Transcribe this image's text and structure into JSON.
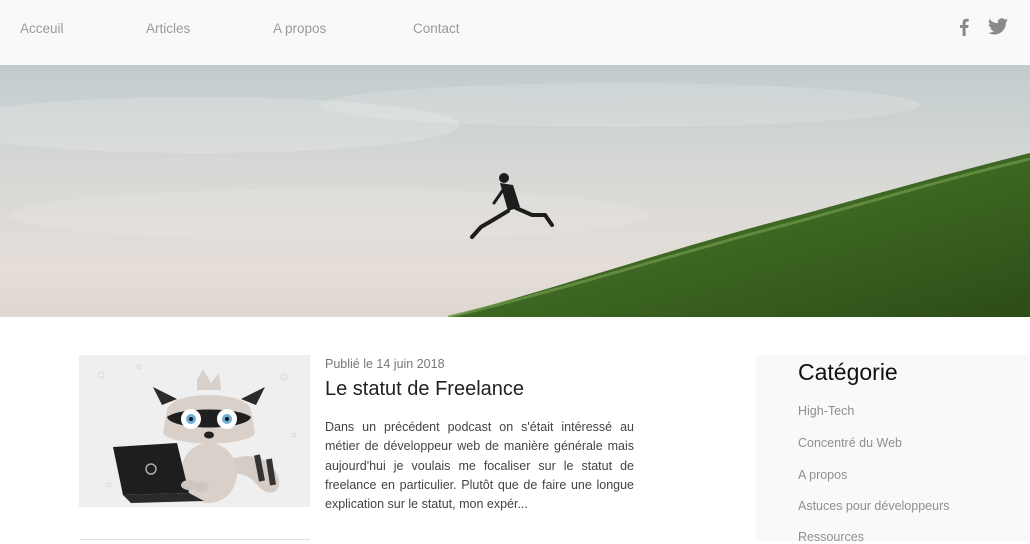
{
  "nav": {
    "items": [
      {
        "label": "Acceuil"
      },
      {
        "label": "Articles"
      },
      {
        "label": "A propos"
      },
      {
        "label": "Contact"
      }
    ],
    "social": {
      "facebook_icon": "facebook-icon",
      "twitter_icon": "twitter-icon"
    }
  },
  "hero": {
    "image": "person-jumping-on-hillside"
  },
  "article": {
    "published": "Publié le 14 juin 2018",
    "title": "Le statut de Freelance",
    "excerpt": "Dans un précédent podcast on s'était intéressé au métier de développeur web de manière générale mais aujourd'hui je voulais me focaliser sur le statut de freelance en particulier. Plutôt que de faire une longue explication sur le statut, mon expér...",
    "thumbnail": "raccoon-with-laptop"
  },
  "sidebar": {
    "heading": "Catégorie",
    "categories": [
      {
        "label": "High-Tech"
      },
      {
        "label": "Concentré du Web"
      },
      {
        "label": "A propos"
      },
      {
        "label": "Astuces pour développeurs"
      },
      {
        "label": "Ressources"
      }
    ]
  },
  "colors": {
    "nav_bg": "#f9f9f9",
    "nav_text": "#9a9a9a",
    "sidebar_bg": "#f9f9f9",
    "hill_green": "#3f6a23"
  }
}
